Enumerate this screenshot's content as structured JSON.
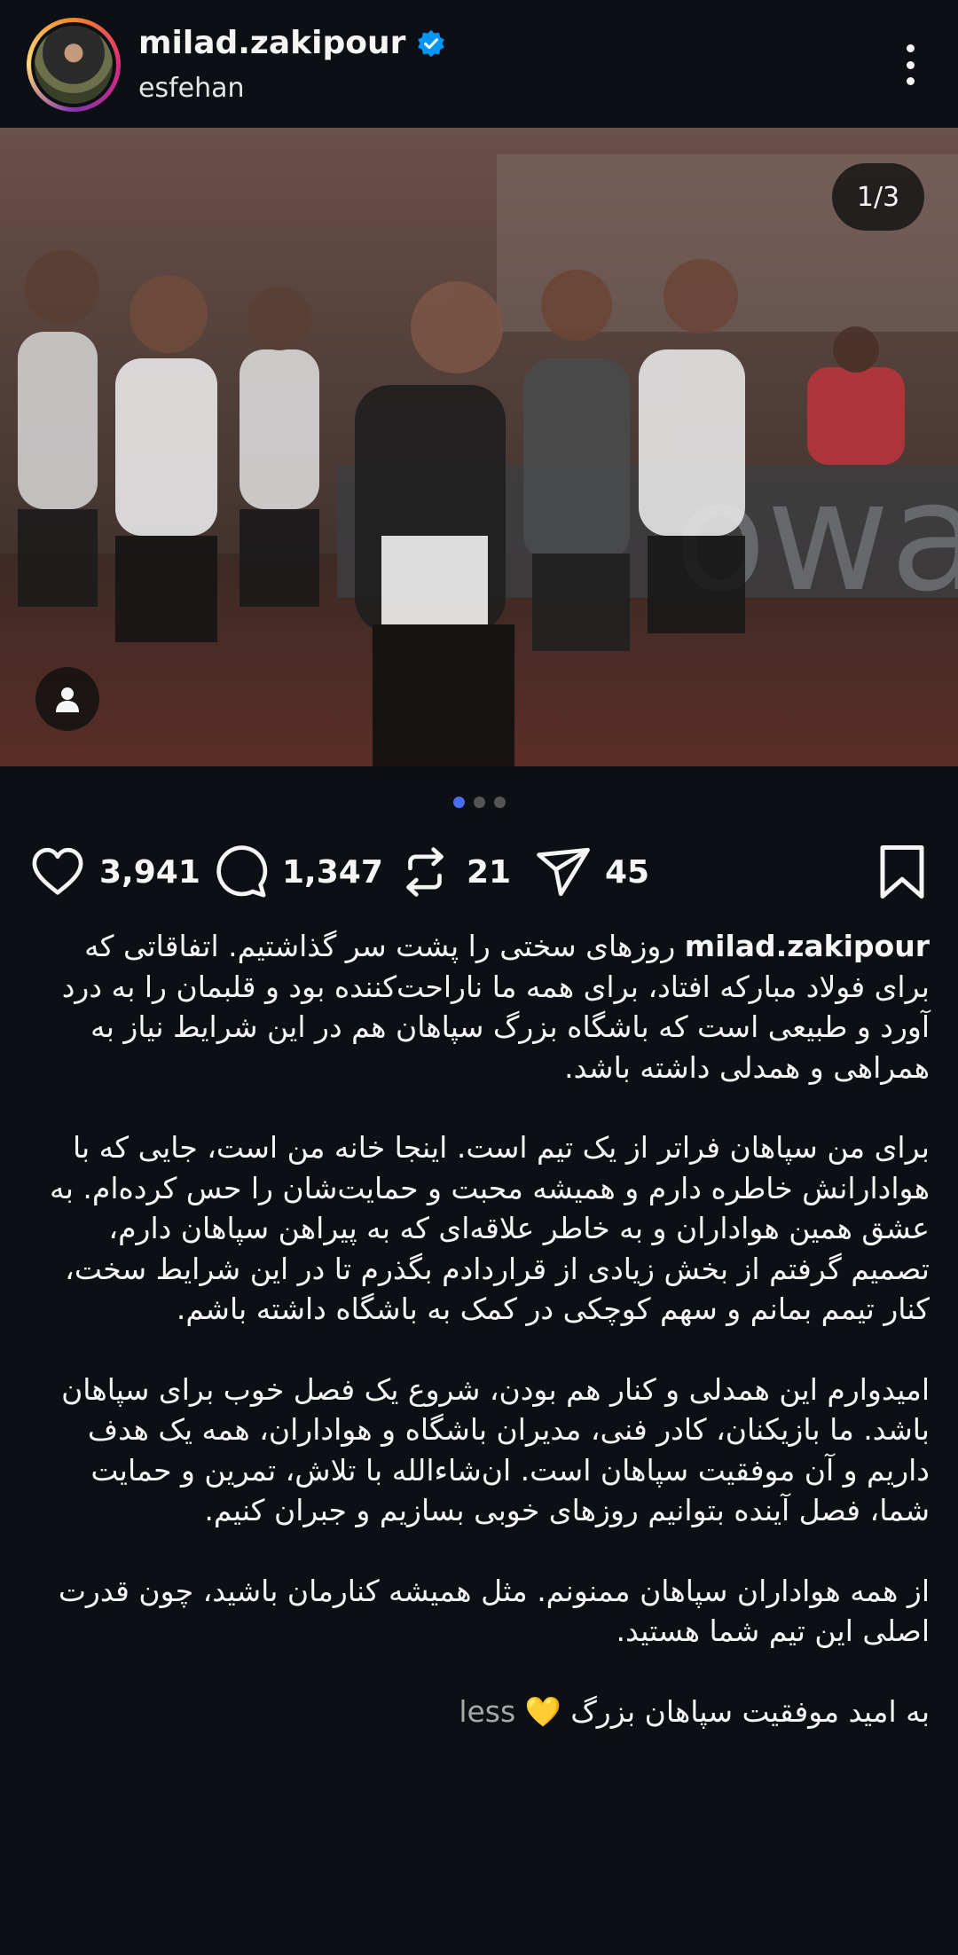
{
  "header": {
    "username": "milad.zakipour",
    "location": "esfehan",
    "verified": true
  },
  "post": {
    "counter": "1/3",
    "carousel_count": 3,
    "carousel_active": 0
  },
  "actions": {
    "likes": "3,941",
    "comments": "1,347",
    "reposts": "21",
    "shares": "45"
  },
  "caption": {
    "username": "milad.zakipour",
    "p1": "روزهای سختی را پشت سر گذاشتیم. اتفاقاتی که برای فولاد مبارکه افتاد، برای همه ما ناراحت‌کننده بود و قلبمان را به درد آورد و طبیعی است که باشگاه بزرگ سپاهان هم در این شرایط نیاز به همراهی و همدلی داشته باشد.",
    "p2": "برای من سپاهان فراتر از یک تیم است. اینجا خانه من است، جایی که با هوادارانش خاطره دارم و همیشه محبت و حمایت‌شان را حس کرده‌ام. به عشق همین هواداران و به خاطر علاقه‌ای که به پیراهن سپاهان دارم، تصمیم گرفتم از بخش زیادی از قراردادم بگذرم تا در این شرایط سخت، کنار تیمم بمانم و سهم کوچکی در کمک به باشگاه داشته باشم.",
    "p3": "امیدوارم این همدلی و کنار هم بودن، شروع یک فصل خوب برای سپاهان باشد. ما بازیکنان، کادر فنی، مدیران باشگاه و هواداران، همه یک هدف داریم و آن موفقیت سپاهان است. ان‌شاءالله با تلاش، تمرین و حمایت شما، فصل آینده بتوانیم روزهای خوبی بسازیم و جبران کنیم.",
    "p4": "از همه هواداران سپاهان ممنونم. مثل همیشه کنارمان باشید، چون قدرت اصلی این تیم شما هستید.",
    "p5": "به امید موفقیت سپاهان بزرگ",
    "heart": "💛",
    "less": "less"
  },
  "colors": {
    "background": "#0c1014",
    "text": "#f5f5f5",
    "verified": "#0095f6",
    "dot_active": "#4a6cf7",
    "muted": "#a8a8a8"
  },
  "icons": [
    "verified-badge-icon",
    "more-options-icon",
    "user-tag-icon",
    "heart-icon",
    "comment-icon",
    "repost-icon",
    "share-icon",
    "bookmark-icon"
  ]
}
